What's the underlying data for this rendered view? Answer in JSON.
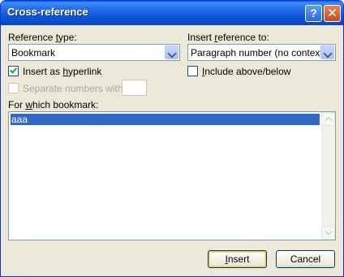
{
  "window": {
    "title": "Cross-reference",
    "help_glyph": "?",
    "close_glyph": "✕"
  },
  "reference_type": {
    "label": "Reference type:",
    "label_pre": "Reference ",
    "label_accel": "t",
    "label_post": "ype:",
    "value": "Bookmark"
  },
  "insert_reference_to": {
    "label": "Insert reference to:",
    "label_pre": "Insert ",
    "label_accel": "r",
    "label_post": "eference to:",
    "value": "Paragraph number (no context)"
  },
  "insert_as_hyperlink": {
    "label": "Insert as hyperlink",
    "label_pre": "Insert as ",
    "label_accel": "h",
    "label_post": "yperlink",
    "checked": true
  },
  "include_above_below": {
    "label": "Include above/below",
    "label_pre": "",
    "label_accel": "I",
    "label_post": "nclude above/below",
    "checked": false
  },
  "separate_numbers": {
    "label": "Separate numbers with",
    "checked": false,
    "enabled": false,
    "value": ""
  },
  "bookmark_list": {
    "label": "For which bookmark:",
    "label_pre": "For ",
    "label_accel": "w",
    "label_post": "hich bookmark:",
    "items": [
      "aaa"
    ],
    "selected_index": 0
  },
  "buttons": {
    "insert": "Insert",
    "insert_accel": "I",
    "insert_post": "nsert",
    "cancel": "Cancel"
  },
  "colors": {
    "title_bar": "#0a52d8",
    "dialog_bg": "#ece9d8",
    "selection": "#316ac5"
  }
}
